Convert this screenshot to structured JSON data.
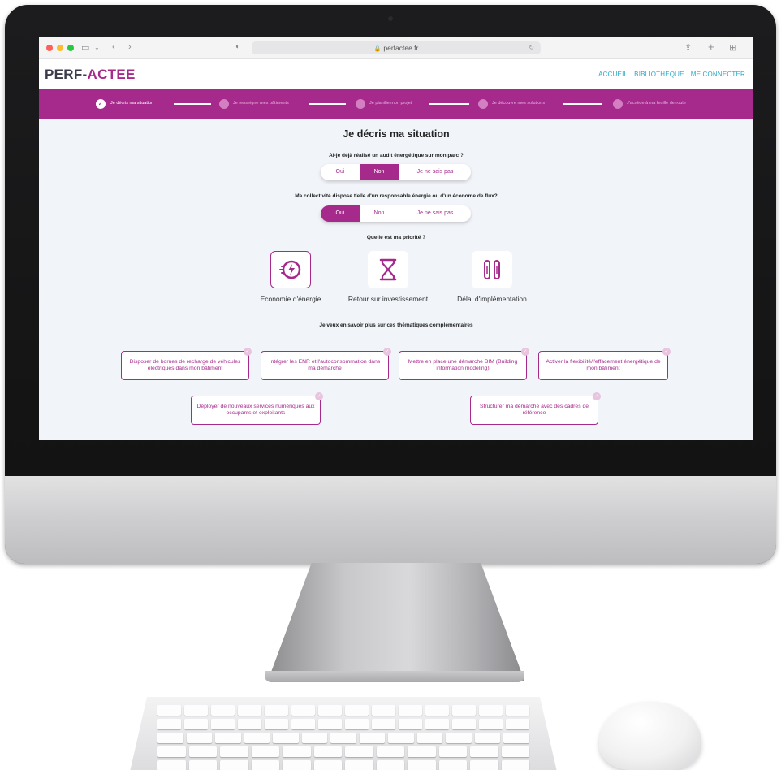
{
  "browser": {
    "url": "perfactee.fr"
  },
  "header": {
    "logo_part1": "PERF-",
    "logo_part2": "ACTEE",
    "nav": [
      "ACCUEIL",
      "BIBLIOTHÈQUE",
      "ME CONNECTER"
    ]
  },
  "stepper": {
    "steps": [
      {
        "label": "Je décris ma situation",
        "active": true
      },
      {
        "label": "Je renseigne mes bâtiments",
        "active": false
      },
      {
        "label": "Je planifie mon projet",
        "active": false
      },
      {
        "label": "Je découvre mes solutions",
        "active": false
      },
      {
        "label": "J'accède à ma feuille de route",
        "active": false
      }
    ]
  },
  "main": {
    "title": "Je décris ma situation",
    "q1": {
      "text": "Ai-je déjà réalisé un audit énergétique sur mon parc ?",
      "options": [
        "Oui",
        "Non",
        "Je ne sais pas"
      ],
      "selected": "Non"
    },
    "q2": {
      "text": "Ma collectivité dispose t'elle d'un responsable énergie ou d'un économe de flux?",
      "options": [
        "Oui",
        "Non",
        "Je ne sais pas"
      ],
      "selected": "Oui"
    },
    "q3": {
      "text": "Quelle est ma priorité ?",
      "priorities": [
        {
          "label": "Economie d'énergie",
          "icon": "energy-plug-icon",
          "selected": true
        },
        {
          "label": "Retour sur investissement",
          "icon": "hourglass-icon",
          "selected": false
        },
        {
          "label": "Délai d'implémentation",
          "icon": "tools-icon",
          "selected": false
        }
      ]
    },
    "q4": {
      "text": "Je veux en savoir plus sur ces thématiques complémentaires",
      "topics": [
        "Disposer de bornes de recharge de véhicules électriques dans mon bâtiment",
        "Intégrer les ENR et l'autoconsommation dans ma démarche",
        "Mettre en place une démarche BIM (Building information modeling)",
        "Activer la flexibilité/l'effacement énergétique de mon bâtiment",
        "Déployer de nouveaux services numériques aux occupants et exploitants",
        "Structurer ma démarche avec des cadres de référence"
      ]
    }
  },
  "colors": {
    "brand": "#a52a8c",
    "nav_link": "#2aa9c9",
    "screen_bg": "#f1f4f9"
  }
}
